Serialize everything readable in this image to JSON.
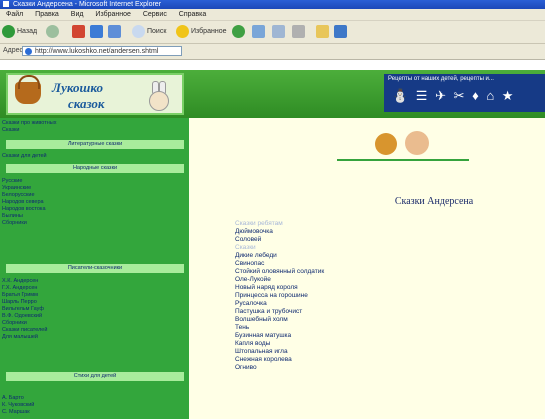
{
  "browser": {
    "title": "Сказки Андерсена - Microsoft Internet Explorer",
    "menu": [
      "Файл",
      "Правка",
      "Вид",
      "Избранное",
      "Сервис",
      "Справка"
    ],
    "toolbar": {
      "back_label": "Назад",
      "search_label": "Поиск",
      "favorites_label": "Избранное"
    },
    "address_label": "Адрес",
    "address_value": "http://www.lukoshko.net/andersen.shtml"
  },
  "header": {
    "logo_line1": "Лукошко",
    "logo_line2": "сказок",
    "banner_text": "Рецепты от наших детей, рецепты и...",
    "banner_icons": "⛄ ☰ ✈ ✂ ♦ ⌂ ★"
  },
  "sidebar": {
    "top_links": [
      "Сказки про животных",
      "Сказки"
    ],
    "sections": [
      {
        "title": "Литературные сказки",
        "links": [
          "Сказки для детей"
        ]
      },
      {
        "title": "Народные сказки",
        "links": [
          "Русские",
          "Украинские",
          "Белорусские",
          "Народов севера",
          "Народов востока",
          "Былины",
          "Сборники"
        ]
      },
      {
        "title": "Писатели-сказочники",
        "links": [
          "Х.К. Андерсен",
          "Г.Х. Андерсен",
          "Братья Гримм",
          "Шарль Перро",
          "Вильгельм Гауф",
          "В.Ф. Одоевский",
          "Сборники",
          "Сказки писателей",
          "Для малышей"
        ]
      },
      {
        "title": "Стихи для детей",
        "links": [
          "А. Барто",
          "К. Чуковский",
          "С. Маршак"
        ]
      }
    ]
  },
  "content": {
    "title": "Сказки Андерсена",
    "groups": [
      {
        "heading": "Сказки ребятам",
        "items": [
          "Дюймовочка",
          "Соловей"
        ]
      },
      {
        "heading": "Сказки",
        "items": [
          "Дикие лебеди",
          "Свинопас",
          "Стойкий оловянный солдатик",
          "Оле-Лукойе",
          "Новый наряд короля",
          "Принцесса на горошине",
          "Русалочка",
          "Пастушка и трубочист",
          "Волшебный холм",
          "Тень",
          "Бузинная матушка",
          "Капля воды",
          "Штопальная игла",
          "Снежная королева",
          "Огниво"
        ]
      }
    ]
  },
  "colors": {
    "header_green": "#3e9e30",
    "sidebar_green": "#33a63c",
    "section_bar": "#a8ec9c",
    "content_bg": "#ffffe6",
    "link_blue": "#0f2a70"
  }
}
